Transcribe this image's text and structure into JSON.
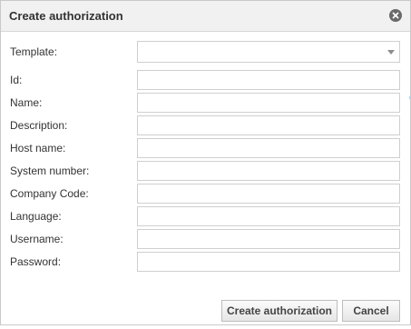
{
  "dialog": {
    "title": "Create authorization",
    "close_icon": "close-circle-icon"
  },
  "form": {
    "template": {
      "label": "Template:",
      "value": ""
    },
    "fields": [
      {
        "key": "id",
        "label": "Id:",
        "value": ""
      },
      {
        "key": "name",
        "label": "Name:",
        "value": ""
      },
      {
        "key": "description",
        "label": "Description:",
        "value": ""
      },
      {
        "key": "host_name",
        "label": "Host name:",
        "value": ""
      },
      {
        "key": "system_number",
        "label": "System number:",
        "value": ""
      },
      {
        "key": "company_code",
        "label": "Company Code:",
        "value": ""
      },
      {
        "key": "language",
        "label": "Language:",
        "value": ""
      },
      {
        "key": "username",
        "label": "Username:",
        "value": ""
      },
      {
        "key": "password",
        "label": "Password:",
        "value": ""
      }
    ]
  },
  "buttons": {
    "create_label": "Create authorization",
    "cancel_label": "Cancel"
  }
}
